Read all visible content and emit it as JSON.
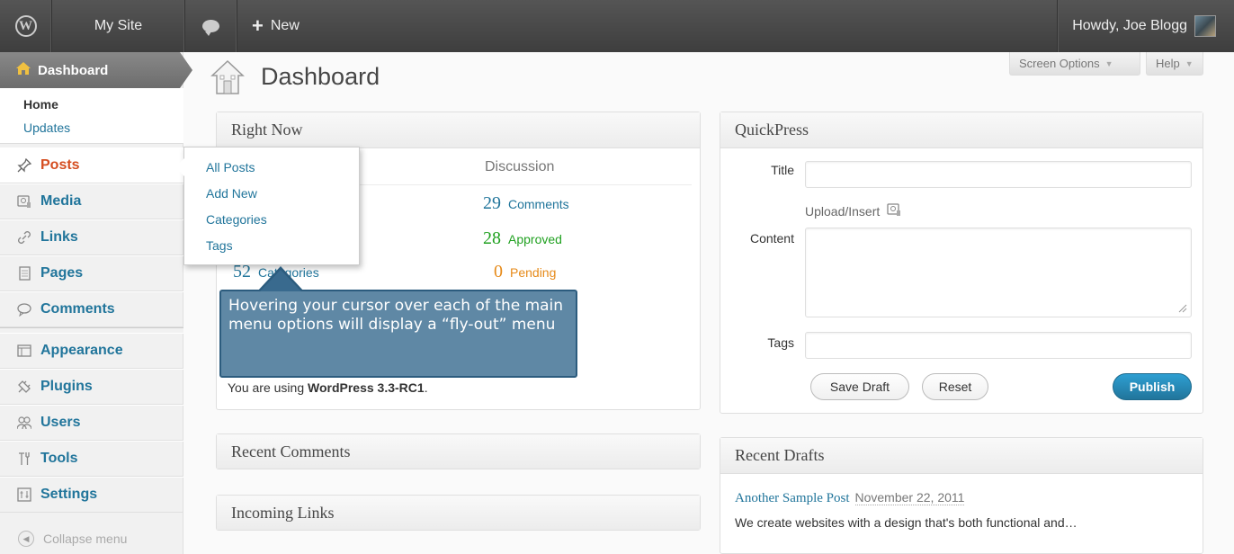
{
  "adminbar": {
    "site_name": "My Site",
    "new_label": "New",
    "howdy": "Howdy, Joe Blogg"
  },
  "sidebar": {
    "dashboard": "Dashboard",
    "dashboard_sub": [
      "Home",
      "Updates"
    ],
    "items": [
      {
        "label": "Posts",
        "icon": "pin-icon"
      },
      {
        "label": "Media",
        "icon": "media-icon"
      },
      {
        "label": "Links",
        "icon": "link-icon"
      },
      {
        "label": "Pages",
        "icon": "pages-icon"
      },
      {
        "label": "Comments",
        "icon": "comment-icon"
      },
      {
        "label": "Appearance",
        "icon": "appearance-icon"
      },
      {
        "label": "Plugins",
        "icon": "plugin-icon"
      },
      {
        "label": "Users",
        "icon": "users-icon"
      },
      {
        "label": "Tools",
        "icon": "tools-icon"
      },
      {
        "label": "Settings",
        "icon": "settings-icon"
      }
    ],
    "collapse": "Collapse menu"
  },
  "flyout": [
    "All Posts",
    "Add New",
    "Categories",
    "Tags"
  ],
  "header": {
    "title": "Dashboard",
    "screen_options": "Screen Options",
    "help": "Help"
  },
  "right_now": {
    "title": "Right Now",
    "discussion_label": "Discussion",
    "categories_num": "52",
    "categories_label": "Categories",
    "comments_num": "29",
    "comments_label": "Comments",
    "approved_num": "28",
    "approved_label": "Approved",
    "pending_num": "0",
    "pending_label": "Pending",
    "version_prefix": "You are using ",
    "version": "WordPress 3.3-RC1",
    "version_suffix": "."
  },
  "callout": {
    "text": "Hovering your cursor over each of the main menu options will display a “fly-out” menu"
  },
  "quickpress": {
    "title": "QuickPress",
    "title_label": "Title",
    "upload_label": "Upload/Insert",
    "content_label": "Content",
    "tags_label": "Tags",
    "save_draft": "Save Draft",
    "reset": "Reset",
    "publish": "Publish"
  },
  "recent_comments": {
    "title": "Recent Comments"
  },
  "incoming_links": {
    "title": "Incoming Links"
  },
  "recent_drafts": {
    "title": "Recent Drafts",
    "post_title": "Another Sample Post",
    "post_date": "November 22, 2011",
    "excerpt": "We create websites with a design that's both functional and…"
  },
  "colors": {
    "link": "#21759b",
    "active_menu": "#d54e21",
    "approved": "#21a121",
    "pending": "#e68a19",
    "publish": "#21759b"
  }
}
